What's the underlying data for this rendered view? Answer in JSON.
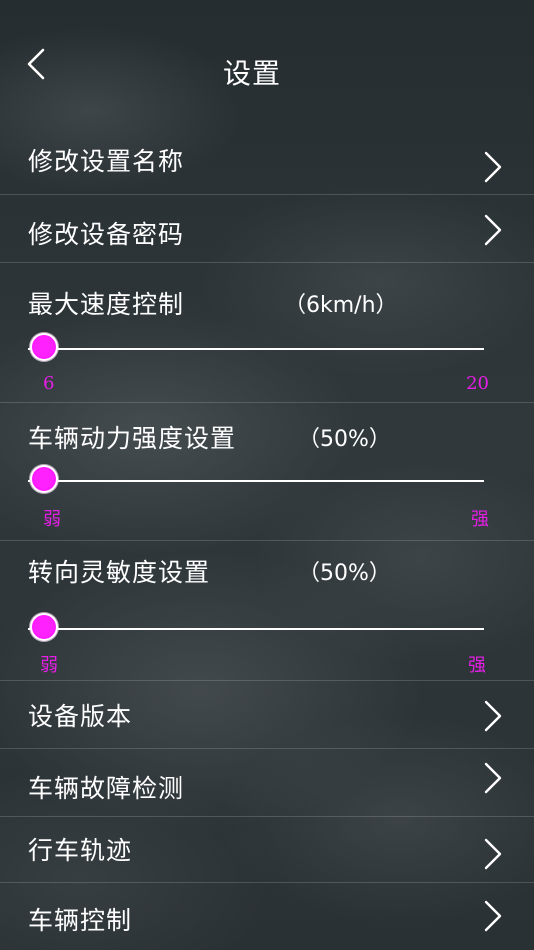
{
  "header": {
    "title": "设置"
  },
  "menu": {
    "rename_label": "修改设置名称",
    "password_label": "修改设备密码",
    "version_label": "设备版本",
    "fault_label": "车辆故障检测",
    "track_label": "行车轨迹",
    "control_label": "车辆控制"
  },
  "speed": {
    "label": "最大速度控制",
    "value_text": "（6km/h）",
    "value": 6,
    "min": 6,
    "max": 20,
    "min_label": "6",
    "max_label": "20"
  },
  "power": {
    "label": "车辆动力强度设置",
    "value_text": "（50%）",
    "value_fraction": 0.0,
    "min_label": "弱",
    "max_label": "强"
  },
  "steering": {
    "label": "转向灵敏度设置",
    "value_text": "（50%）",
    "value_fraction": 0.0,
    "min_label": "弱",
    "max_label": "强"
  },
  "colors": {
    "accent": "#ff1aff",
    "accent_text": "#e61ee6",
    "text": "#ffffff"
  },
  "icons": {
    "back": "chevron-left-icon",
    "chevron": "chevron-right-icon"
  }
}
